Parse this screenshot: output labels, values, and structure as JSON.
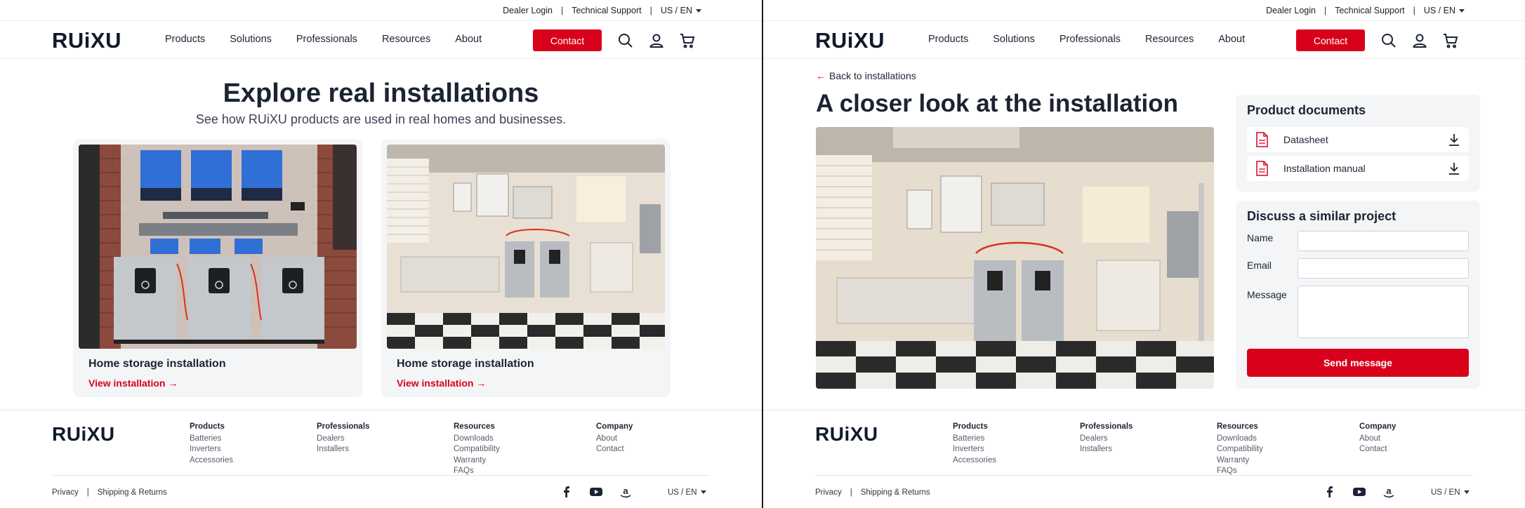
{
  "brand": {
    "logo_text": "RUiXU",
    "accent": "#d9001b",
    "text_dark": "#1c2433"
  },
  "utility": {
    "dealer_login": "Dealer Login",
    "tech_support": "Technical Support",
    "sep": "|",
    "locale": "US / EN"
  },
  "nav": {
    "products": "Products",
    "solutions": "Solutions",
    "professionals": "Professionals",
    "resources": "Resources",
    "about": "About",
    "contact": "Contact"
  },
  "header_icons": [
    "search-icon",
    "user-icon",
    "cart-icon"
  ],
  "listing": {
    "title": "Explore real installations",
    "subtitle": "See how RUiXU products are used in real homes and businesses.",
    "cards": [
      {
        "title": "Home storage installation",
        "link": "View installation →"
      },
      {
        "title": "Home storage installation",
        "link": "View installation →"
      }
    ]
  },
  "detail": {
    "back": "Back to installations",
    "title": "A closer look at the installation",
    "docs_title": "Product documents",
    "docs": [
      {
        "label": "Datasheet"
      },
      {
        "label": "Installation manual"
      }
    ],
    "form_title": "Discuss a similar project",
    "form": {
      "name_label": "Name",
      "email_label": "Email",
      "message_label": "Message",
      "send": "Send message"
    }
  },
  "footer": {
    "products": {
      "heading": "Products",
      "items": [
        "Batteries",
        "Inverters",
        "Accessories"
      ]
    },
    "professionals": {
      "heading": "Professionals",
      "items": [
        "Dealers",
        "Installers"
      ]
    },
    "resources": {
      "heading": "Resources",
      "items": [
        "Downloads",
        "Compatibility",
        "Warranty",
        "FAQs"
      ]
    },
    "company": {
      "heading": "Company",
      "items": [
        "About",
        "Contact"
      ]
    },
    "privacy": "Privacy",
    "shipping": "Shipping & Returns",
    "sep": "|",
    "locale": "US / EN",
    "social_icons": [
      "facebook-icon",
      "youtube-icon",
      "amazon-icon"
    ]
  }
}
